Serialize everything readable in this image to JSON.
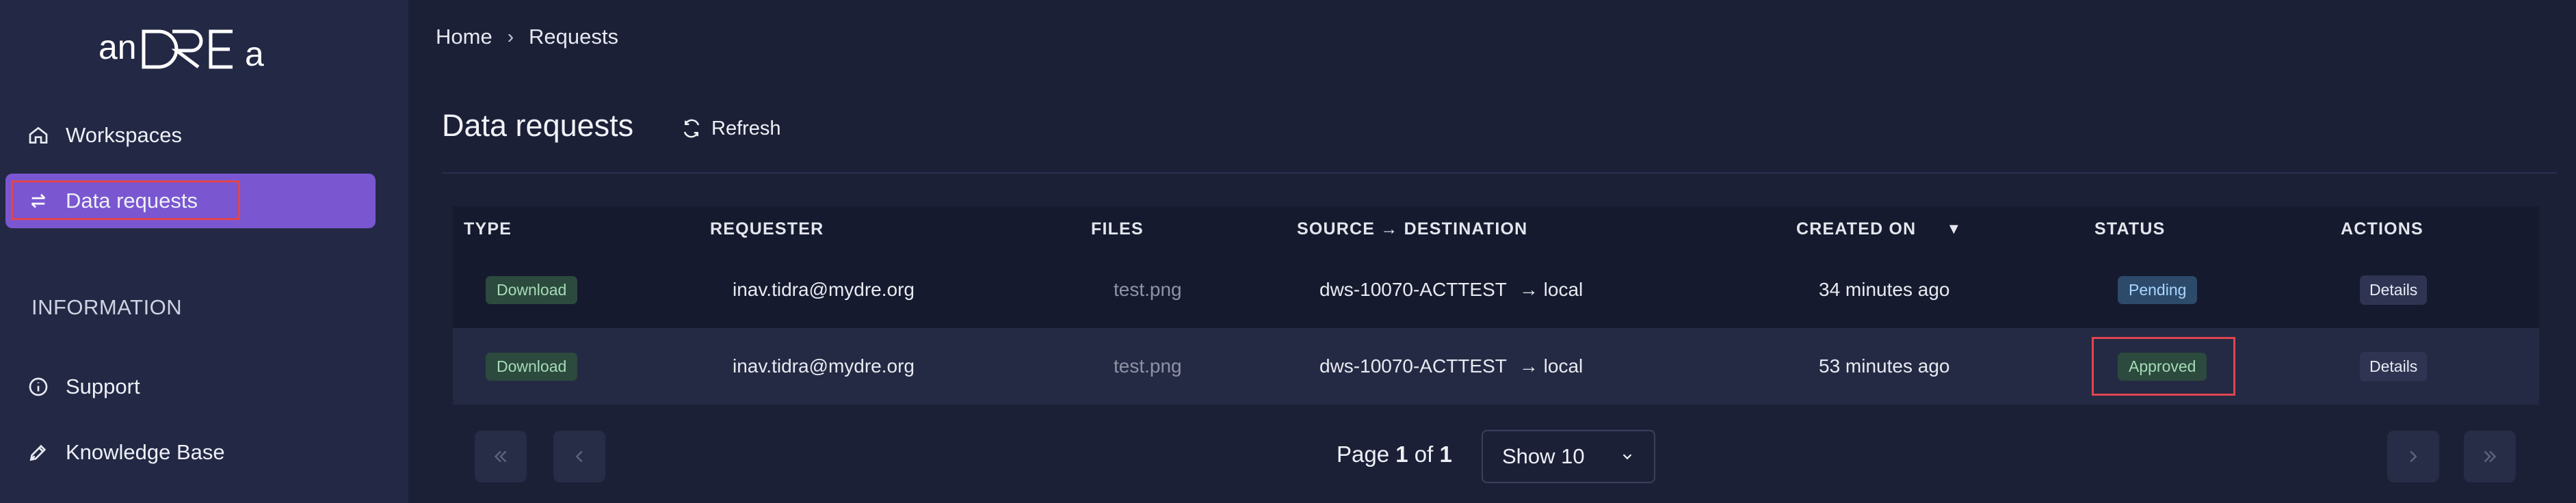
{
  "app": {
    "logo_text": "anDRE a"
  },
  "colors": {
    "accent": "#7a57d1",
    "background": "#1c2037",
    "sidebar": "#232845",
    "highlight": "#e0454f"
  },
  "sidebar": {
    "items": [
      {
        "label": "Workspaces",
        "icon": "home-icon"
      },
      {
        "label": "Data requests",
        "icon": "swap-arrows-icon",
        "active": true
      }
    ],
    "info_title": "INFORMATION",
    "info_items": [
      {
        "label": "Support",
        "icon": "info-circle-icon"
      },
      {
        "label": "Knowledge Base",
        "icon": "pen-nib-icon"
      }
    ]
  },
  "breadcrumb": {
    "home": "Home",
    "separator": "›",
    "current": "Requests"
  },
  "page": {
    "title": "Data requests",
    "refresh_label": "Refresh"
  },
  "table": {
    "headers": {
      "type": "TYPE",
      "requester": "REQUESTER",
      "files": "FILES",
      "source_destination": "SOURCE → DESTINATION",
      "created_on": "CREATED ON",
      "sort_indicator": "▼",
      "status": "STATUS",
      "actions": "ACTIONS"
    },
    "rows": [
      {
        "type": "Download",
        "requester": "inav.tidra@mydre.org",
        "files": "test.png",
        "source": "dws-10070-ACTTEST",
        "destination": "→ local",
        "created_on": "34 minutes ago",
        "status": "Pending",
        "action": "Details"
      },
      {
        "type": "Download",
        "requester": "inav.tidra@mydre.org",
        "files": "test.png",
        "source": "dws-10070-ACTTEST",
        "destination": "→ local",
        "created_on": "53 minutes ago",
        "status": "Approved",
        "action": "Details"
      }
    ]
  },
  "pagination": {
    "page_prefix": "Page ",
    "current_page": "1",
    "of_text": " of ",
    "total_pages": "1",
    "show_label": "Show 10"
  }
}
